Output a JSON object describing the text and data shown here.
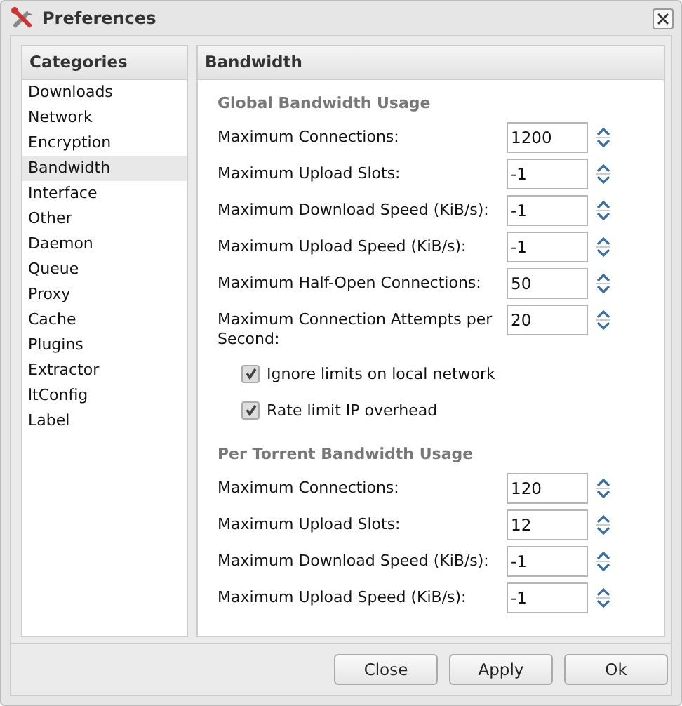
{
  "window": {
    "title": "Preferences"
  },
  "sidebar": {
    "heading": "Categories",
    "items": [
      {
        "label": "Downloads",
        "selected": false
      },
      {
        "label": "Network",
        "selected": false
      },
      {
        "label": "Encryption",
        "selected": false
      },
      {
        "label": "Bandwidth",
        "selected": true
      },
      {
        "label": "Interface",
        "selected": false
      },
      {
        "label": "Other",
        "selected": false
      },
      {
        "label": "Daemon",
        "selected": false
      },
      {
        "label": "Queue",
        "selected": false
      },
      {
        "label": "Proxy",
        "selected": false
      },
      {
        "label": "Cache",
        "selected": false
      },
      {
        "label": "Plugins",
        "selected": false
      },
      {
        "label": "Extractor",
        "selected": false
      },
      {
        "label": "ltConfig",
        "selected": false
      },
      {
        "label": "Label",
        "selected": false
      }
    ]
  },
  "panel": {
    "title": "Bandwidth",
    "sections": [
      {
        "title": "Global Bandwidth Usage",
        "fields": [
          {
            "label": "Maximum Connections:",
            "value": "1200"
          },
          {
            "label": "Maximum Upload Slots:",
            "value": "-1"
          },
          {
            "label": "Maximum Download Speed (KiB/s):",
            "value": "-1"
          },
          {
            "label": "Maximum Upload Speed (KiB/s):",
            "value": "-1"
          },
          {
            "label": "Maximum Half-Open Connections:",
            "value": "50"
          },
          {
            "label": "Maximum Connection Attempts per Second:",
            "value": "20"
          }
        ],
        "checkboxes": [
          {
            "label": "Ignore limits on local network",
            "checked": true
          },
          {
            "label": "Rate limit IP overhead",
            "checked": true
          }
        ]
      },
      {
        "title": "Per Torrent Bandwidth Usage",
        "fields": [
          {
            "label": "Maximum Connections:",
            "value": "120"
          },
          {
            "label": "Maximum Upload Slots:",
            "value": "12"
          },
          {
            "label": "Maximum Download Speed (KiB/s):",
            "value": "-1"
          },
          {
            "label": "Maximum Upload Speed (KiB/s):",
            "value": "-1"
          }
        ]
      }
    ]
  },
  "buttons": [
    "Close",
    "Apply",
    "Ok"
  ]
}
